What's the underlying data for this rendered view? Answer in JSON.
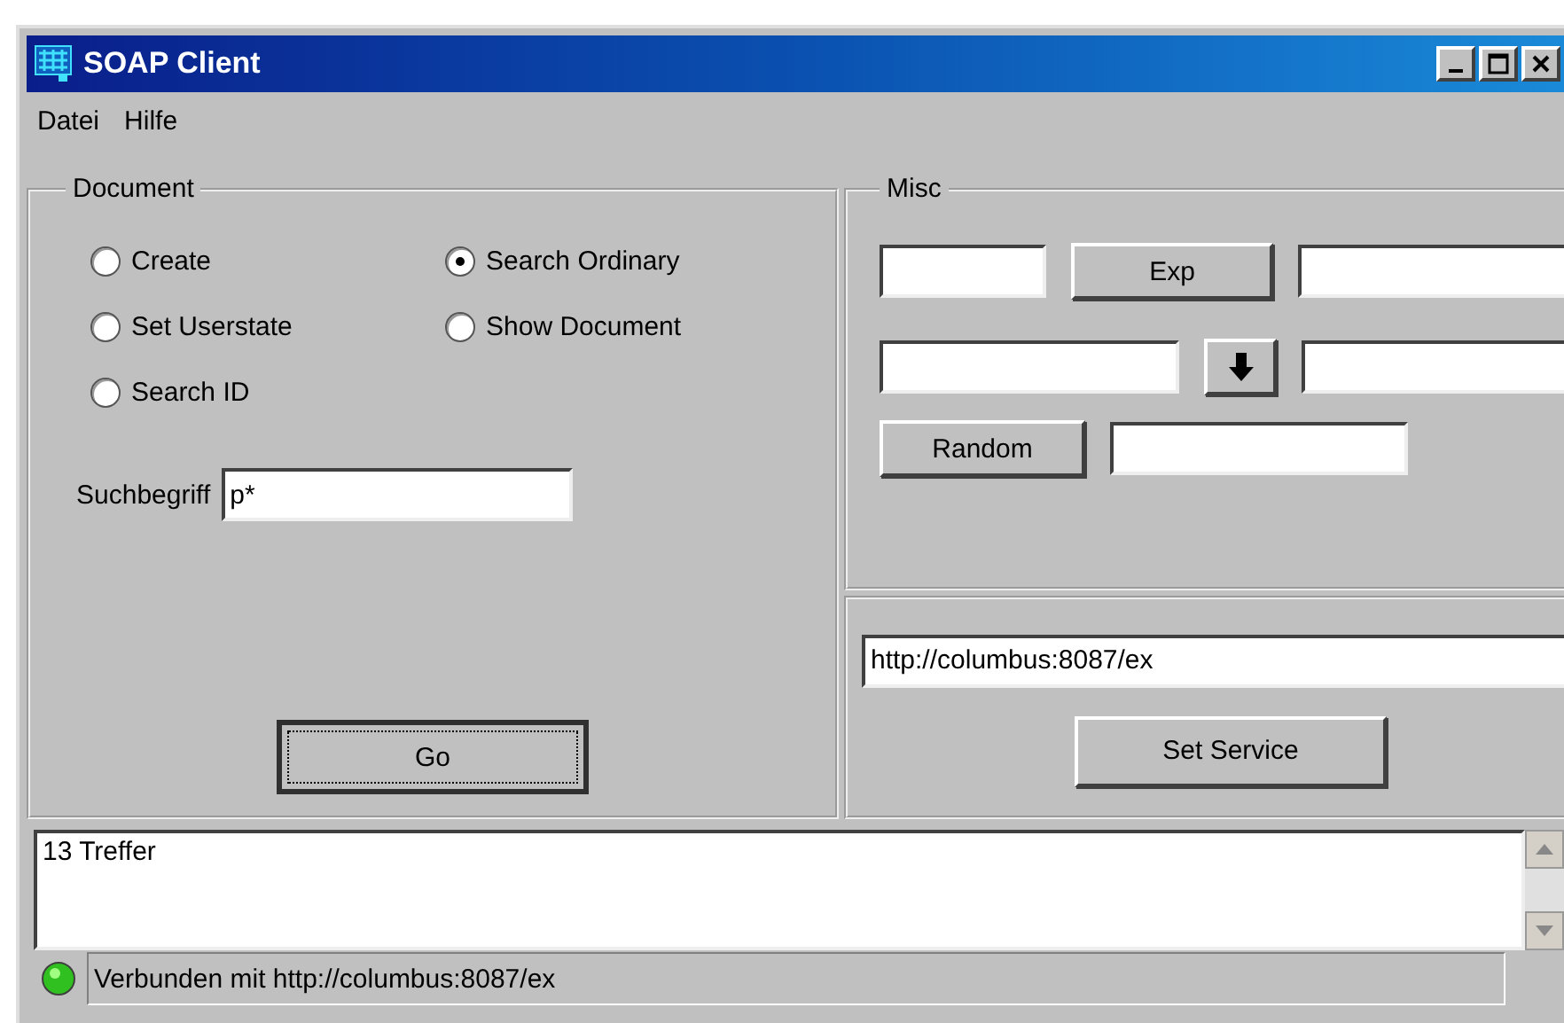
{
  "window": {
    "title": "SOAP Client"
  },
  "menu": [
    {
      "label": "Datei"
    },
    {
      "label": "Hilfe"
    }
  ],
  "document": {
    "title": "Document",
    "options": [
      {
        "label": "Create",
        "selected": false
      },
      {
        "label": "Search Ordinary",
        "selected": true
      },
      {
        "label": "Set Userstate",
        "selected": false
      },
      {
        "label": "Show Document",
        "selected": false
      },
      {
        "label": "Search ID",
        "selected": false
      }
    ],
    "search_label": "Suchbegriff",
    "search_value": "p*",
    "go_button": "Go"
  },
  "misc": {
    "title": "Misc",
    "exp_button": "Exp",
    "random_button": "Random"
  },
  "service": {
    "url": "http://columbus:8087/ex",
    "button": "Set Service"
  },
  "output": {
    "text": "13 Treffer"
  },
  "status_bar": {
    "connected": true,
    "text": "Verbunden mit http://columbus:8087/ex"
  }
}
